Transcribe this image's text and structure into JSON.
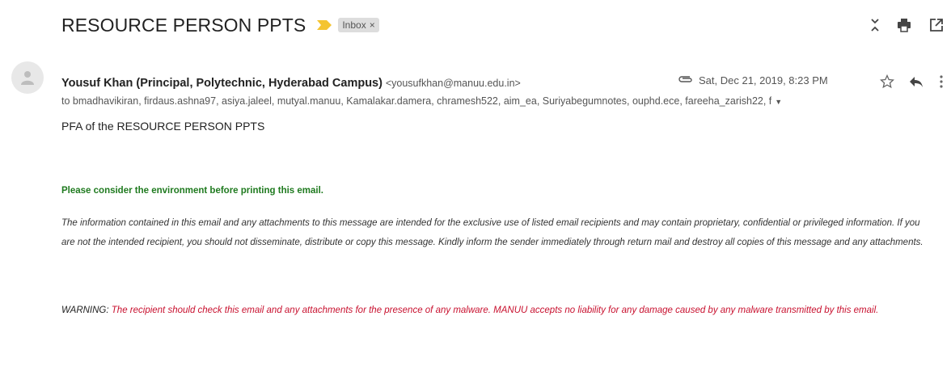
{
  "subject": "RESOURCE PERSON PPTS",
  "label": {
    "text": "Inbox",
    "remove_icon": "close-icon"
  },
  "icons": {
    "importance": "importance-marker-icon",
    "expand": "expand-collapse-icon",
    "print": "print-icon",
    "new_window": "open-in-new-window-icon",
    "avatar": "default-avatar-icon",
    "attachment": "paperclip-icon",
    "star": "star-icon",
    "reply": "reply-icon",
    "more": "more-vertical-icon",
    "recipients_caret": "caret-down-icon"
  },
  "sender": {
    "name": "Yousuf Khan (Principal, Polytechnic, Hyderabad Campus)",
    "email": "<yousufkhan@manuu.edu.in>"
  },
  "date": "Sat, Dec 21, 2019, 8:23 PM",
  "recipients": "to bmadhavikiran, firdaus.ashna97, asiya.jaleel, mutyal.manuu, Kamalakar.damera, chramesh522, aim_ea, Suriyabegumnotes, ouphd.ece, fareeha_zarish22, f",
  "body": "PFA of the RESOURCE PERSON PPTS",
  "environment_note": "Please consider the environment before printing this email.",
  "disclaimer": "The information contained in this email and any attachments to this message are intended for the exclusive use of listed email recipients and may contain proprietary, confidential or privileged information. If you are not the intended recipient, you should not disseminate, distribute or copy this message. Kindly inform the sender immediately through return mail and destroy all copies of this message and any attachments.",
  "warning": {
    "label": "WARNING:",
    "text": " The recipient should check this email and any attachments for the presence of any malware. MANUU accepts no liability for any damage caused by any malware transmitted by this email."
  },
  "colors": {
    "importance": "#f4c430",
    "env_note": "#1f7a1f",
    "warning_text": "#c8102e",
    "label_bg": "#dddddd"
  }
}
